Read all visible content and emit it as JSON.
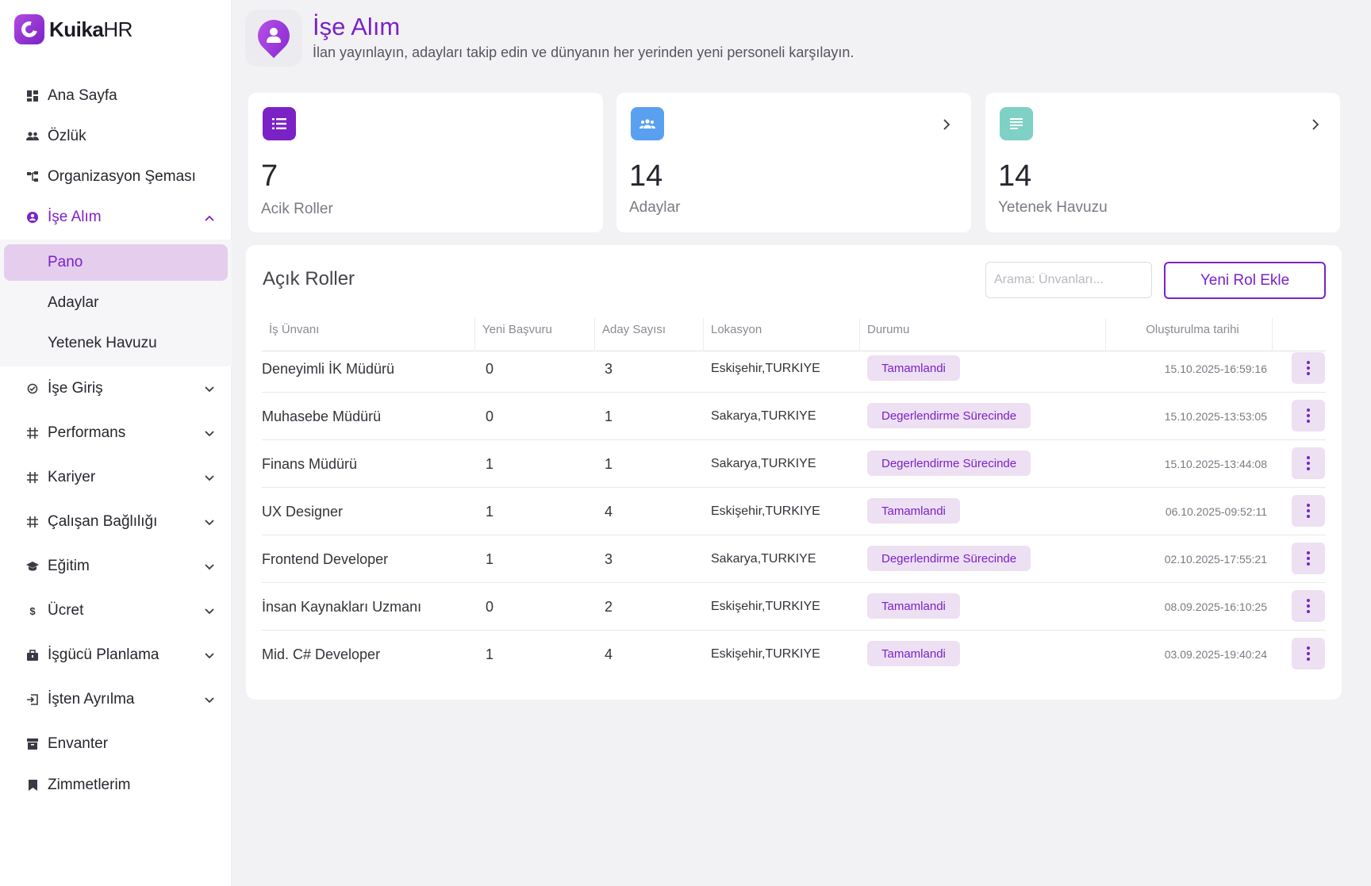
{
  "app": {
    "name_bold": "Kuika",
    "name_light": "HR"
  },
  "colors": {
    "accent": "#7b22c7",
    "badge_bg": "#ede0f3",
    "selected_bg": "#e5cdee",
    "card1_icon": "#7b22c7",
    "card2_icon": "#5aa0f0",
    "card3_icon": "#7fd1c6"
  },
  "sidebar": {
    "items": [
      {
        "label": "Ana Sayfa",
        "icon": "dashboard-icon"
      },
      {
        "label": "Özlük",
        "icon": "people-icon"
      },
      {
        "label": "Organizasyon Şeması",
        "icon": "org-chart-icon"
      },
      {
        "label": "İşe Alım",
        "icon": "person-badge-icon"
      },
      {
        "label": "İşe Giriş",
        "icon": "onboarding-icon"
      },
      {
        "label": "Performans",
        "icon": "grid-hash-icon"
      },
      {
        "label": "Kariyer",
        "icon": "grid-hash-icon"
      },
      {
        "label": "Çalışan Bağlılığı",
        "icon": "grid-hash-icon"
      },
      {
        "label": "Eğitim",
        "icon": "graduation-cap-icon"
      },
      {
        "label": "Ücret",
        "icon": "dollar-icon"
      },
      {
        "label": "İşgücü Planlama",
        "icon": "briefcase-icon"
      },
      {
        "label": "İşten Ayrılma",
        "icon": "exit-icon"
      },
      {
        "label": "Envanter",
        "icon": "archive-icon"
      },
      {
        "label": "Zimmetlerim",
        "icon": "bookmark-icon"
      }
    ],
    "subitems": [
      {
        "label": "Pano"
      },
      {
        "label": "Adaylar"
      },
      {
        "label": "Yetenek Havuzu"
      }
    ]
  },
  "header": {
    "title": "İşe Alım",
    "subtitle": "İlan yayınlayın, adayları takip edin ve dünyanın her yerinden yeni personeli karşılayın."
  },
  "cards": [
    {
      "value": "7",
      "label": "Acik Roller",
      "icon": "list-icon"
    },
    {
      "value": "14",
      "label": "Adaylar",
      "icon": "group-icon"
    },
    {
      "value": "14",
      "label": "Yetenek Havuzu",
      "icon": "notes-icon"
    }
  ],
  "table": {
    "title": "Açık Roller",
    "search_placeholder": "Arama: Ünvanları...",
    "add_button": "Yeni Rol Ekle",
    "columns": [
      "İş Ünvanı",
      "Yeni Başvuru",
      "Aday Sayısı",
      "Lokasyon",
      "Durumu",
      "Oluşturulma tarihi"
    ],
    "rows": [
      {
        "title": "Deneyimli İK Müdürü",
        "new": "0",
        "count": "3",
        "location": "Eskişehir,TURKIYE",
        "status": "Tamamlandi",
        "date": "15.10.2025-16:59:16"
      },
      {
        "title": "Muhasebe Müdürü",
        "new": "0",
        "count": "1",
        "location": "Sakarya,TURKIYE",
        "status": "Degerlendirme Sürecinde",
        "date": "15.10.2025-13:53:05"
      },
      {
        "title": "Finans Müdürü",
        "new": "1",
        "count": "1",
        "location": "Sakarya,TURKIYE",
        "status": "Degerlendirme Sürecinde",
        "date": "15.10.2025-13:44:08"
      },
      {
        "title": "UX Designer",
        "new": "1",
        "count": "4",
        "location": "Eskişehir,TURKIYE",
        "status": "Tamamlandi",
        "date": "06.10.2025-09:52:11"
      },
      {
        "title": "Frontend Developer",
        "new": "1",
        "count": "3",
        "location": "Sakarya,TURKIYE",
        "status": "Degerlendirme Sürecinde",
        "date": "02.10.2025-17:55:21"
      },
      {
        "title": "İnsan Kaynakları Uzmanı",
        "new": "0",
        "count": "2",
        "location": "Eskişehir,TURKIYE",
        "status": "Tamamlandi",
        "date": "08.09.2025-16:10:25"
      },
      {
        "title": "Mid. C# Developer",
        "new": "1",
        "count": "4",
        "location": "Eskişehir,TURKIYE",
        "status": "Tamamlandi",
        "date": "03.09.2025-19:40:24"
      }
    ]
  }
}
